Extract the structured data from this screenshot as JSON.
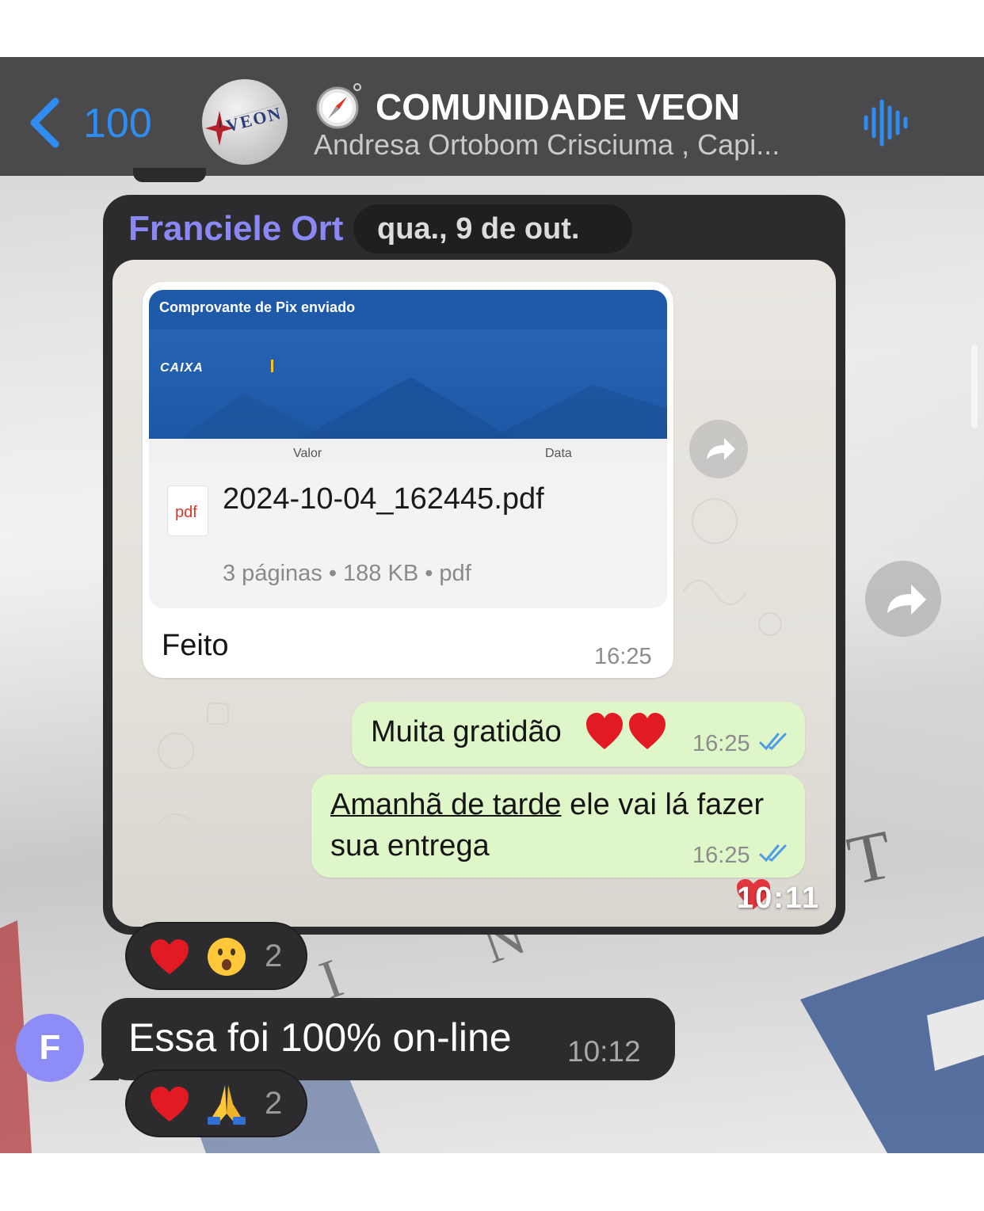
{
  "header": {
    "back_count": "100",
    "title": "COMUNIDADE VEON",
    "subtitle": "Andresa Ortobom Crisciuma , Capi...",
    "avatar_text": "VEON",
    "accent_color": "#2f8cf0"
  },
  "quoted": {
    "sender_name": "Franciele Ort",
    "date_chip": "qua., 9 de out."
  },
  "document": {
    "preview_title": "Comprovante de Pix enviado",
    "preview_logo": "CAIXA",
    "preview_col1": "Valor",
    "preview_col2": "Data",
    "file_icon_label": "pdf",
    "file_name": "2024-10-04_162445.pdf",
    "file_meta": "3 páginas • 188 KB • pdf",
    "caption": "Feito",
    "time": "16:25"
  },
  "outgoing": [
    {
      "text": "Muita gratidão",
      "emoji": "❤️❤️",
      "time": "16:25",
      "status": "read"
    },
    {
      "text_underlined": "Amanhã de tarde",
      "text_rest": " ele vai lá fazer sua entrega",
      "time": "16:25",
      "status": "read"
    }
  ],
  "overlay_time": "10:11",
  "reactions_1": {
    "emojis": [
      "❤️",
      "😮"
    ],
    "count": "2"
  },
  "message": {
    "avatar_letter": "F",
    "text": "Essa foi 100% on-line",
    "time": "10:12"
  },
  "reactions_2": {
    "emojis": [
      "❤️",
      "🙏"
    ],
    "count": "2"
  }
}
